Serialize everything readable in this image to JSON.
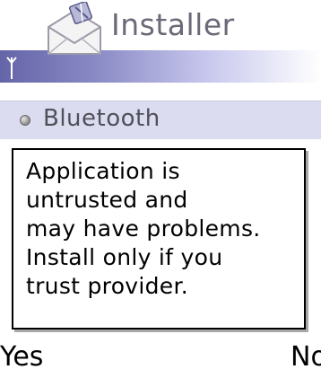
{
  "header": {
    "title": "Installer",
    "icons": [
      "installer-envelope-icon",
      "signal-antenna-icon"
    ]
  },
  "list": {
    "items": [
      {
        "label": "Bluetooth",
        "icon": "bullet-icon"
      }
    ]
  },
  "dialog": {
    "message": "Application is\nuntrusted and\nmay have problems.\nInstall only if you\ntrust provider."
  },
  "softkeys": {
    "left": "Yes",
    "right": "No"
  },
  "colors": {
    "title_strip_start": "#6464a8",
    "list_highlight": "#dcdcf0",
    "title_text": "#6a6a78"
  }
}
